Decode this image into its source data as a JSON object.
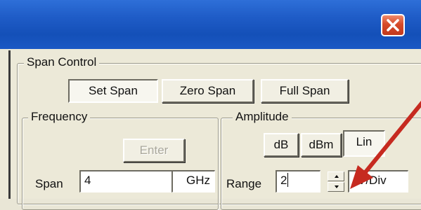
{
  "window": {
    "close_icon": "close-x-icon",
    "accent_titlebar": "#1f5cc7",
    "close_color": "#d64a2a"
  },
  "span_control": {
    "legend": "Span Control",
    "buttons": [
      {
        "label": "Set Span",
        "pressed": true
      },
      {
        "label": "Zero Span",
        "pressed": false
      },
      {
        "label": "Full Span",
        "pressed": false
      }
    ]
  },
  "frequency": {
    "legend": "Frequency",
    "enter_label": "Enter",
    "span_label": "Span",
    "span_value": "4",
    "span_unit": "GHz"
  },
  "amplitude": {
    "legend": "Amplitude",
    "unit_buttons": [
      {
        "label": "dB",
        "pressed": false
      },
      {
        "label": "dBm",
        "pressed": false
      },
      {
        "label": "Lin",
        "pressed": true
      }
    ],
    "range_label": "Range",
    "range_value": "2",
    "range_unit": "V/Div"
  },
  "annotation": {
    "arrow_color": "#c62a20",
    "arrow_icon": "pointer-arrow-icon"
  }
}
